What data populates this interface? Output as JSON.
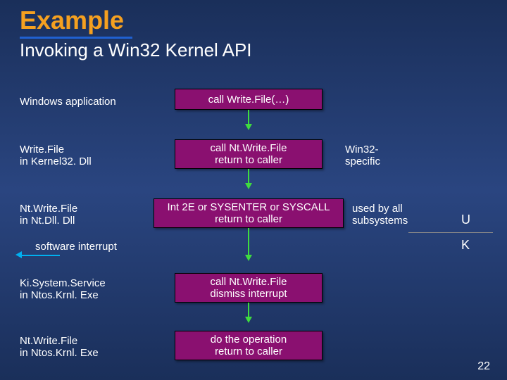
{
  "title": "Example",
  "subtitle": "Invoking a Win32 Kernel API",
  "rows": [
    {
      "label": "Windows application",
      "box_l1": "call Write.File(…)",
      "box_l2": "",
      "note_l1": "",
      "note_l2": ""
    },
    {
      "label_l1": "Write.File",
      "label_l2": "in Kernel32. Dll",
      "box_l1": "call Nt.Write.File",
      "box_l2": "return to caller",
      "note_l1": "Win32-",
      "note_l2": "specific"
    },
    {
      "label_l1": "Nt.Write.File",
      "label_l2": "in Nt.Dll. Dll",
      "box_l1": "Int 2E or SYSENTER or SYSCALL",
      "box_l2": "return to caller",
      "note_l1": "used by all",
      "note_l2": "subsystems"
    },
    {
      "label_l1": "Ki.System.Service",
      "label_l2": "in Ntos.Krnl. Exe",
      "box_l1": "call Nt.Write.File",
      "box_l2": "dismiss interrupt",
      "note_l1": "",
      "note_l2": ""
    },
    {
      "label_l1": "Nt.Write.File",
      "label_l2": "in Ntos.Krnl. Exe",
      "box_l1": "do the operation",
      "box_l2": "return to caller",
      "note_l1": "",
      "note_l2": ""
    }
  ],
  "software_interrupt_label": "software interrupt",
  "mode_u": "U",
  "mode_k": "K",
  "page_number": "22"
}
